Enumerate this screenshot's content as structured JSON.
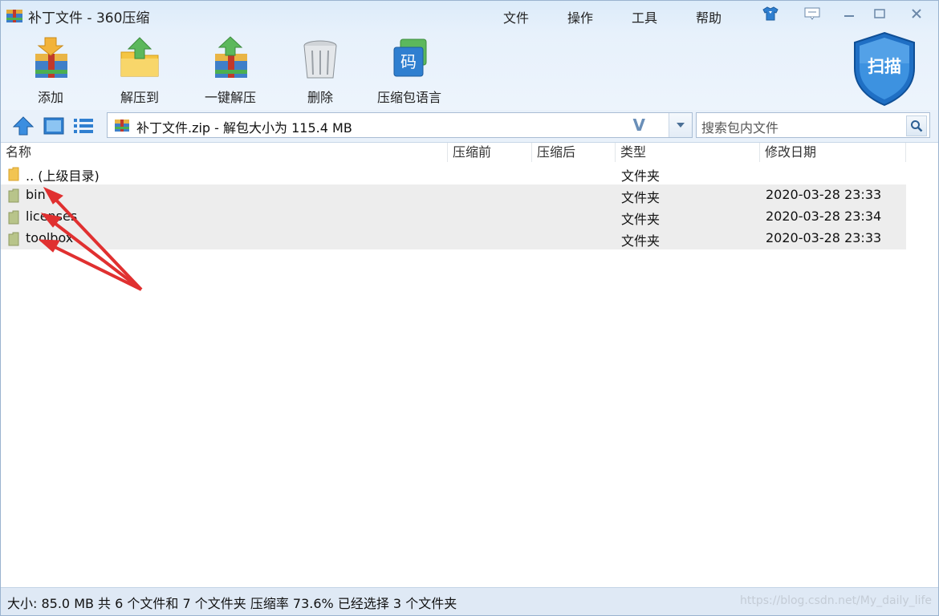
{
  "window": {
    "title": "补丁文件 - 360压缩"
  },
  "menu": [
    "文件",
    "操作",
    "工具",
    "帮助"
  ],
  "toolbar": {
    "add": "添加",
    "extract_to": "解压到",
    "one_click_extract": "一键解压",
    "delete": "删除",
    "archive_language": "压缩包语言",
    "lang_icon_char": "码",
    "scan": "扫描"
  },
  "address": {
    "path": "补丁文件.zip - 解包大小为 115.4 MB",
    "separator": "V"
  },
  "search": {
    "placeholder": "搜索包内文件"
  },
  "columns": [
    "名称",
    "压缩前",
    "压缩后",
    "类型",
    "修改日期"
  ],
  "rows": [
    {
      "name": ".. (上级目录)",
      "type": "文件夹",
      "date": ""
    },
    {
      "name": "bin",
      "type": "文件夹",
      "date": "2020-03-28 23:33"
    },
    {
      "name": "licenses",
      "type": "文件夹",
      "date": "2020-03-28 23:34"
    },
    {
      "name": "toolbox",
      "type": "文件夹",
      "date": "2020-03-28 23:33"
    }
  ],
  "status": {
    "text": "大小: 85.0 MB 共 6 个文件和 7 个文件夹 压缩率 73.6% 已经选择 3 个文件夹",
    "watermark": "https://blog.csdn.net/My_daily_life"
  },
  "colors": {
    "accent": "#2f7fd0",
    "annotation_arrow": "#e03030",
    "row_shade": "#ededed"
  },
  "icons": [
    "app-icon",
    "skin-icon",
    "feedback-icon",
    "minimize-icon",
    "maximize-icon",
    "close-icon",
    "up-icon",
    "view-large-icon",
    "view-list-icon",
    "zip-icon",
    "search-icon",
    "folder-icon"
  ]
}
